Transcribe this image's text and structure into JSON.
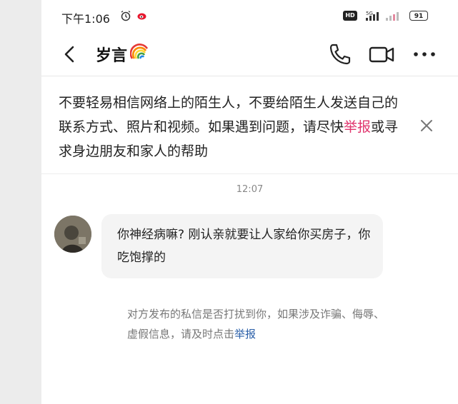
{
  "status_bar": {
    "time": "下午1:06",
    "hd": "HD",
    "signal": "5G",
    "battery": "91"
  },
  "header": {
    "title": "岁言"
  },
  "warning": {
    "text_before": "不要轻易相信网络上的陌生人，不要给陌生人发送自己的联系方式、照片和视频。如果遇到问题，请尽快",
    "link": "举报",
    "text_after": "或寻求身边朋友和家人的帮助"
  },
  "chat": {
    "timestamp": "12:07",
    "messages": [
      {
        "text": "你神经病嘛? 刚认亲就要让人家给你买房子，你吃饱撑的"
      }
    ],
    "notice_text": "对方发布的私信是否打扰到你，如果涉及诈骗、侮辱、虚假信息，请及时点击",
    "notice_link": "举报"
  },
  "colors": {
    "warning_link": "#e0356e",
    "notice_link": "#2a5fa8"
  },
  "icons": [
    "alarm-icon",
    "weibo-icon",
    "signal-icon",
    "battery-icon",
    "back-icon",
    "rainbow-emoji",
    "phone-icon",
    "video-icon",
    "more-icon",
    "close-icon"
  ]
}
